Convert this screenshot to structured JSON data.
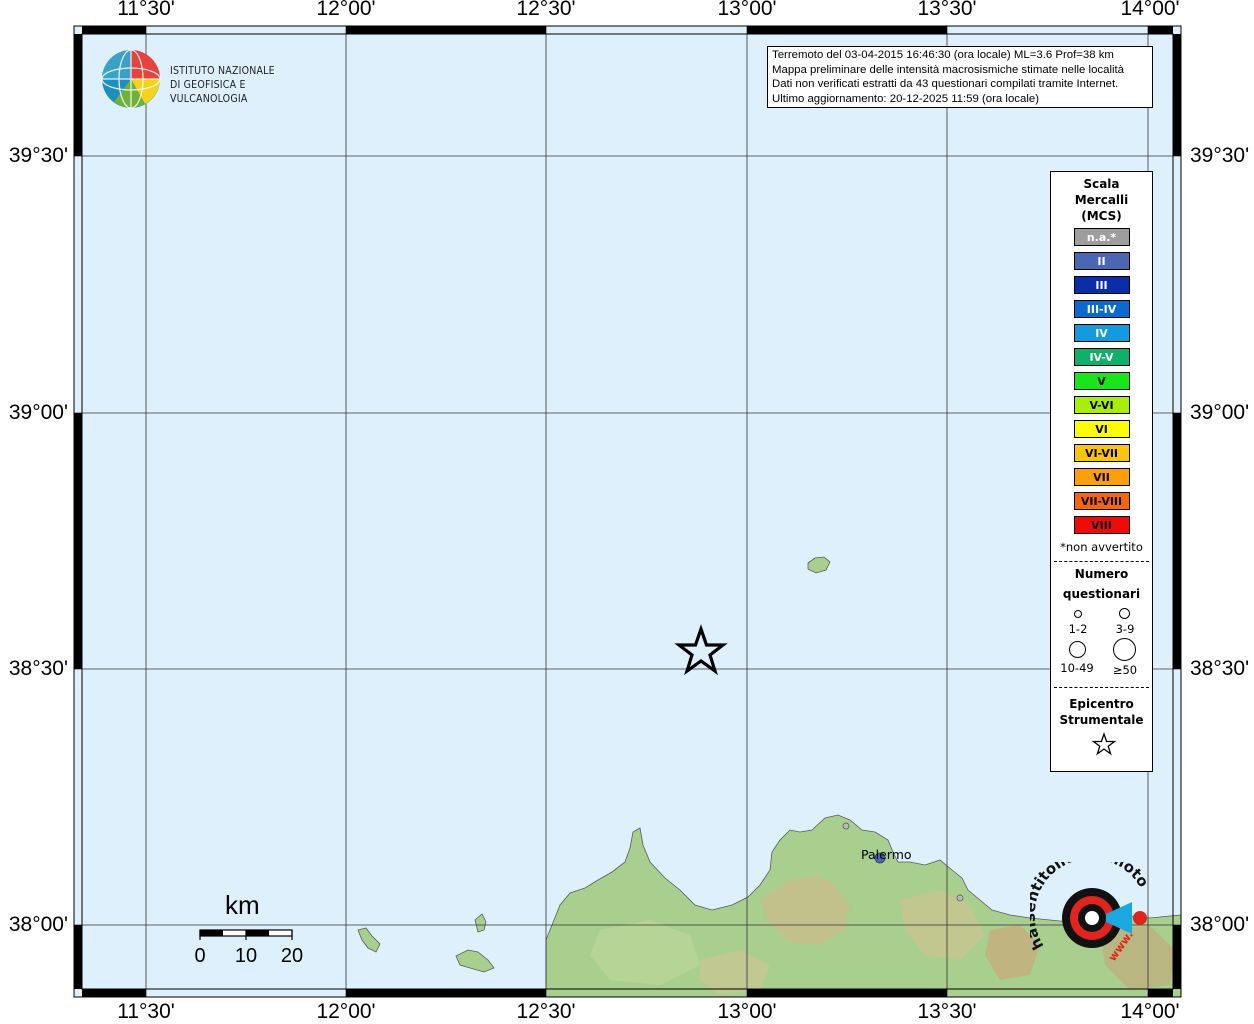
{
  "map": {
    "lon_labels": [
      "11°30'",
      "12°00'",
      "12°30'",
      "13°00'",
      "13°30'",
      "14°00'"
    ],
    "lat_labels": [
      "39°30'",
      "39°00'",
      "38°30'",
      "38°00'"
    ],
    "sea_color": "#dff0fd",
    "land_color": "#a9cf8e"
  },
  "info": {
    "line1": "Terremoto del 03-04-2015 16:46:30 (ora locale) ML=3.6 Prof=38 km",
    "line2": "Mappa preliminare delle intensità macrosismiche stimate nelle località",
    "line3": "Dati non verificati estratti da 43 questionari compilati tramite Internet.",
    "line4": "Ultimo aggiornamento: 20-12-2025 11:59 (ora locale)"
  },
  "logo": {
    "line1": "ISTITUTO NAZIONALE",
    "line2": "DI GEOFISICA E VULCANOLOGIA"
  },
  "legend": {
    "title1": "Scala",
    "title2": "Mercalli",
    "title3": "(MCS)",
    "classes": [
      {
        "label": "n.a.*",
        "color": "#9e9e9e"
      },
      {
        "label": "II",
        "color": "#4c67b1"
      },
      {
        "label": "III",
        "color": "#0a2eaa"
      },
      {
        "label": "III-IV",
        "color": "#0a6ad0"
      },
      {
        "label": "IV",
        "color": "#129bde"
      },
      {
        "label": "IV-V",
        "color": "#10b06a"
      },
      {
        "label": "V",
        "color": "#19e619"
      },
      {
        "label": "V-VI",
        "color": "#a8ee0a"
      },
      {
        "label": "VI",
        "color": "#fcfc05"
      },
      {
        "label": "VI-VII",
        "color": "#fcc40a"
      },
      {
        "label": "VII",
        "color": "#fc9f0a"
      },
      {
        "label": "VII-VIII",
        "color": "#f5650a"
      },
      {
        "label": "VIII",
        "color": "#f00a0a"
      }
    ],
    "note": "*non avvertito",
    "num_title1": "Numero",
    "num_title2": "questionari",
    "sizes": [
      "1-2",
      "3-9",
      "10-49",
      "≥50"
    ],
    "epi_title1": "Epicentro",
    "epi_title2": "Strumentale"
  },
  "places": {
    "palermo": "Palermo"
  },
  "scale": {
    "unit": "km",
    "ticks": [
      "0",
      "10",
      "20"
    ]
  },
  "hsi": {
    "text": "haisentitoilterremoto.it",
    "url_mark": "www."
  }
}
